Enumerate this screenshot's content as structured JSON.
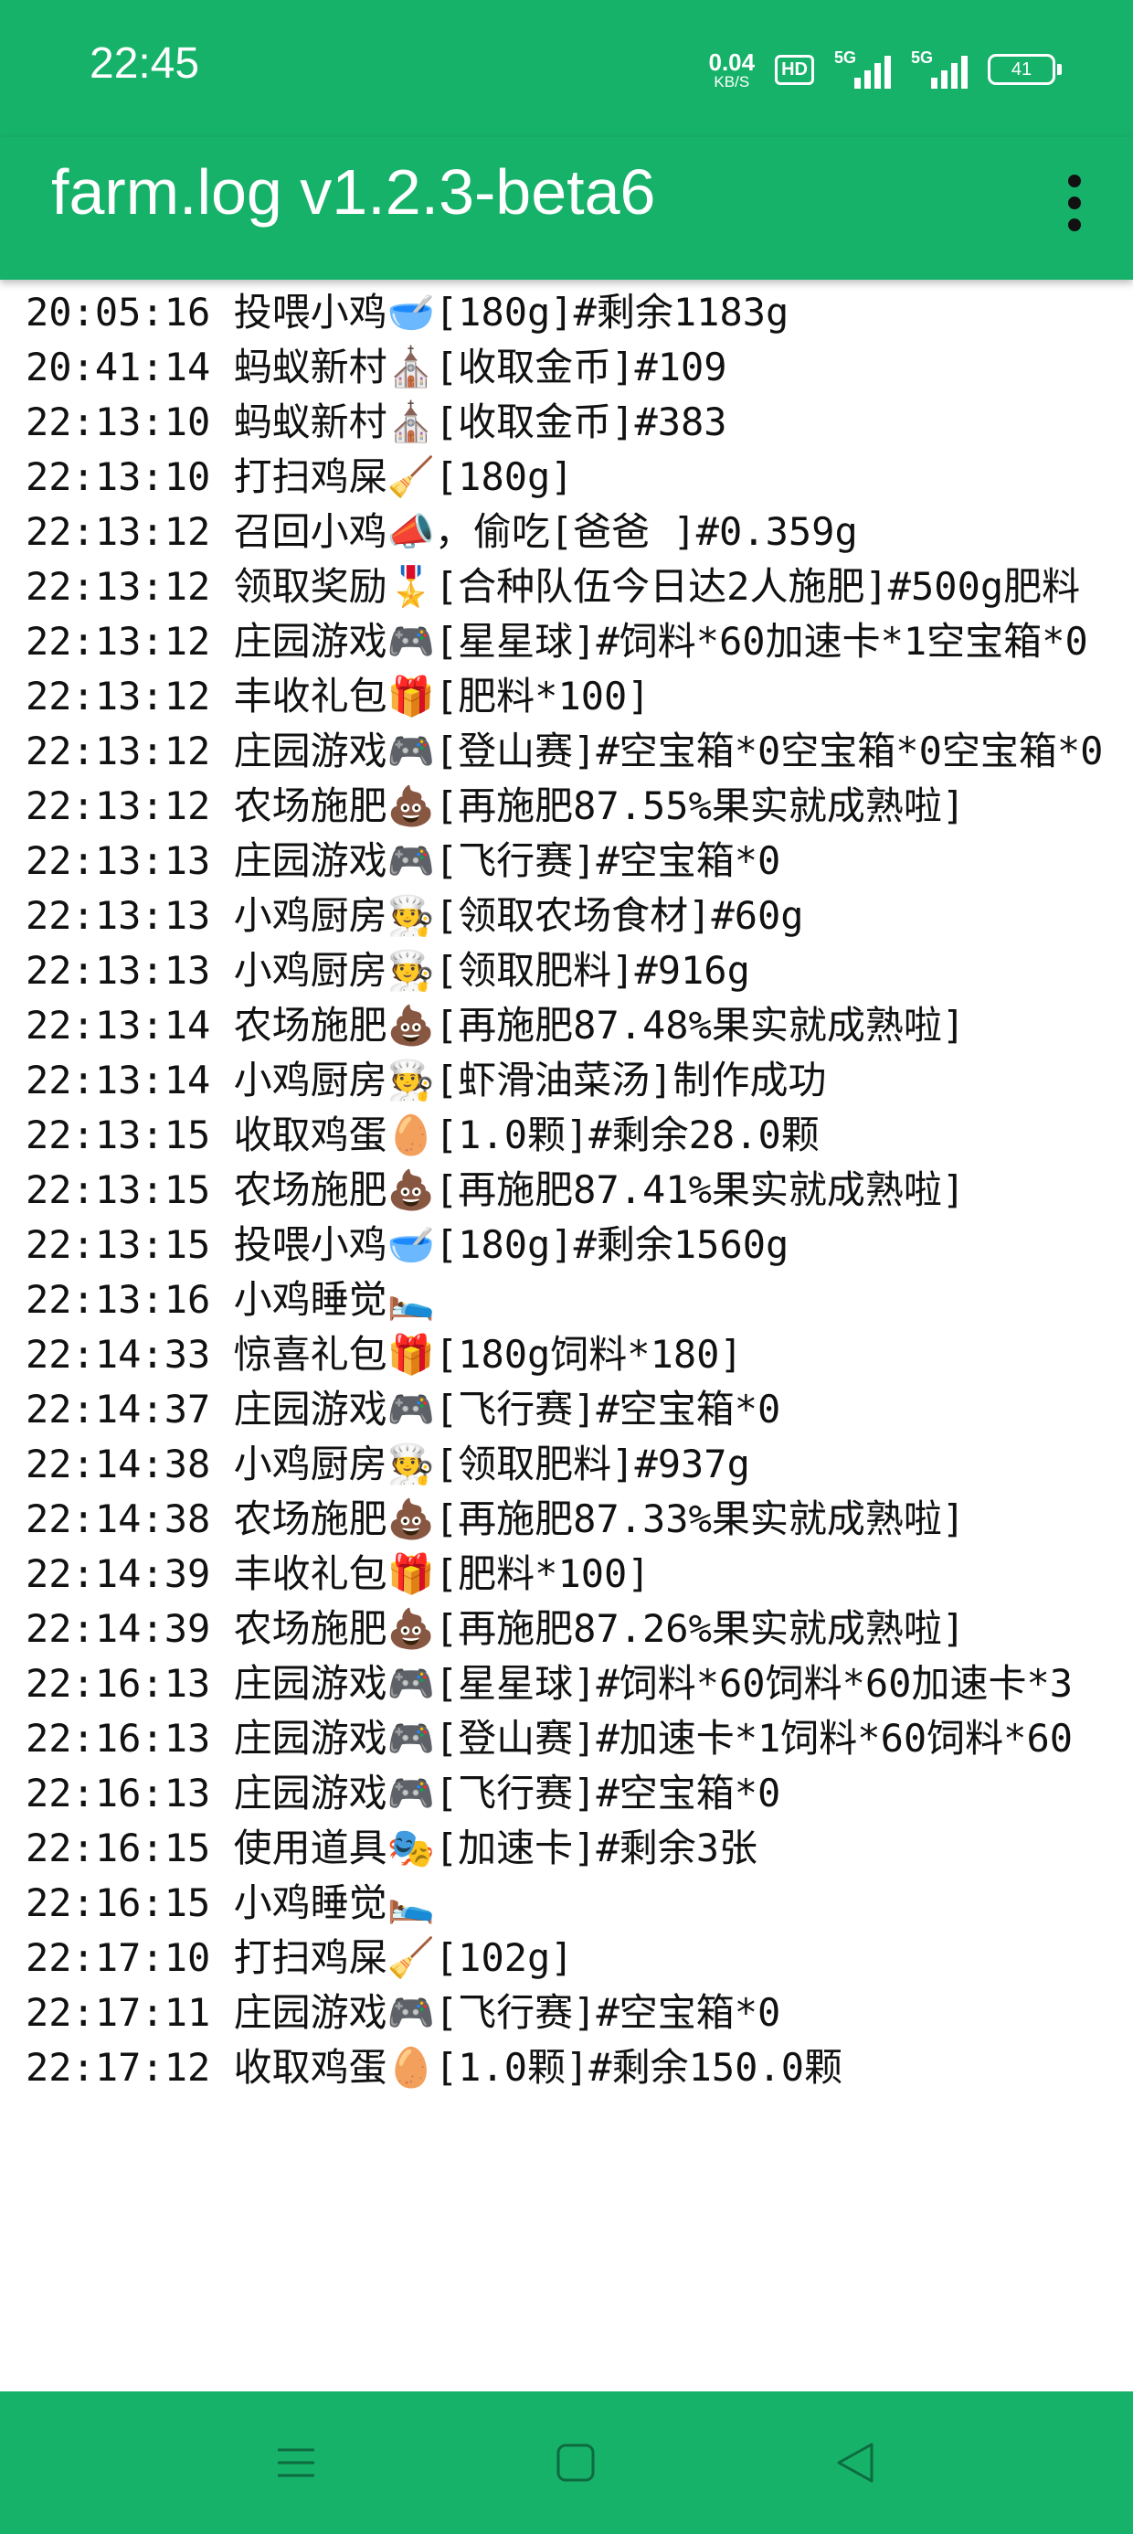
{
  "status_bar": {
    "time": "22:45",
    "net_speed_value": "0.04",
    "net_speed_unit": "KB/S",
    "hd_badge": "HD",
    "signal_1_label": "5G",
    "signal_2_label": "5G",
    "battery_level": "41",
    "icons": [
      "hd-icon",
      "signal-5g-icon",
      "signal-5g-icon",
      "battery-icon"
    ]
  },
  "app_bar": {
    "title": "farm.log v1.2.3-beta6",
    "menu_icon": "overflow-menu-icon"
  },
  "log": {
    "lines": [
      "20:05:16 投喂小鸡🥣[180g]#剩余1183g",
      "20:41:14 蚂蚁新村⛪[收取金币]#109",
      "22:13:10 蚂蚁新村⛪[收取金币]#383",
      "22:13:10 打扫鸡屎🧹[180g]",
      "22:13:12 召回小鸡📣，偷吃[爸爸 ]#0.359g",
      "22:13:12 领取奖励🎖️[合种队伍今日达2人施肥]#500g肥料",
      "22:13:12 庄园游戏🎮[星星球]#饲料*60加速卡*1空宝箱*0",
      "22:13:12 丰收礼包🎁[肥料*100]",
      "22:13:12 庄园游戏🎮[登山赛]#空宝箱*0空宝箱*0空宝箱*0",
      "22:13:12 农场施肥💩[再施肥87.55%果实就成熟啦]",
      "22:13:13 庄园游戏🎮[飞行赛]#空宝箱*0",
      "22:13:13 小鸡厨房🧑‍🍳[领取农场食材]#60g",
      "22:13:13 小鸡厨房🧑‍🍳[领取肥料]#916g",
      "22:13:14 农场施肥💩[再施肥87.48%果实就成熟啦]",
      "22:13:14 小鸡厨房🧑‍🍳[虾滑油菜汤]制作成功",
      "22:13:15 收取鸡蛋🥚[1.0颗]#剩余28.0颗",
      "22:13:15 农场施肥💩[再施肥87.41%果实就成熟啦]",
      "22:13:15 投喂小鸡🥣[180g]#剩余1560g",
      "22:13:16 小鸡睡觉🛌",
      "22:14:33 惊喜礼包🎁[180g饲料*180]",
      "22:14:37 庄园游戏🎮[飞行赛]#空宝箱*0",
      "22:14:38 小鸡厨房🧑‍🍳[领取肥料]#937g",
      "22:14:38 农场施肥💩[再施肥87.33%果实就成熟啦]",
      "22:14:39 丰收礼包🎁[肥料*100]",
      "22:14:39 农场施肥💩[再施肥87.26%果实就成熟啦]",
      "22:16:13 庄园游戏🎮[星星球]#饲料*60饲料*60加速卡*3",
      "22:16:13 庄园游戏🎮[登山赛]#加速卡*1饲料*60饲料*60",
      "22:16:13 庄园游戏🎮[飞行赛]#空宝箱*0",
      "22:16:15 使用道具🎭[加速卡]#剩余3张",
      "22:16:15 小鸡睡觉🛌",
      "22:17:10 打扫鸡屎🧹[102g]",
      "22:17:11 庄园游戏🎮[飞行赛]#空宝箱*0",
      "22:17:12 收取鸡蛋🥚[1.0颗]#剩余150.0颗"
    ]
  },
  "nav_bar": {
    "buttons": [
      "menu-icon",
      "home-icon",
      "back-icon"
    ]
  },
  "colors": {
    "brand_green": "#17b26a",
    "text": "#111111",
    "background": "#ffffff"
  }
}
